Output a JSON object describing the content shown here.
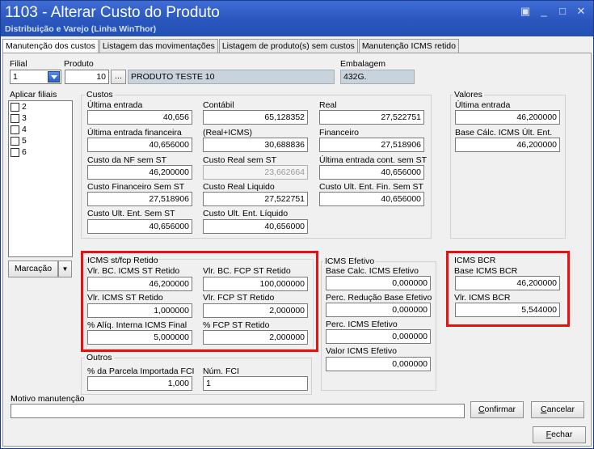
{
  "window": {
    "title": "1103 - Alterar Custo do Produto",
    "subtitle": "Distribuição e Varejo (Linha WinThor)"
  },
  "tabs": [
    {
      "label": "Manutenção dos custos",
      "active": true
    },
    {
      "label": "Listagem das movimentações",
      "active": false
    },
    {
      "label": "Listagem de produto(s)  sem custos",
      "active": false
    },
    {
      "label": "Manutenção ICMS retido",
      "active": false
    }
  ],
  "header": {
    "filial_label": "Filial",
    "filial_value": "1",
    "produto_label": "Produto",
    "produto_code": "10",
    "produto_browse": "...",
    "produto_desc": "PRODUTO TESTE 10",
    "embalagem_label": "Embalagem",
    "embalagem_value": "432G."
  },
  "aplicar_filiais": {
    "label": "Aplicar filiais",
    "items": [
      "2",
      "3",
      "4",
      "5",
      "6"
    ],
    "marcacao_button": "Marcação"
  },
  "custos": {
    "title": "Custos",
    "ultima_entrada": {
      "label": "Última entrada",
      "value": "40,656"
    },
    "contabil": {
      "label": "Contábil",
      "value": "65,128352"
    },
    "real": {
      "label": "Real",
      "value": "27,522751"
    },
    "ult_ent_financeira": {
      "label": "Última entrada financeira",
      "value": "40,656000"
    },
    "real_icms": {
      "label": "(Real+ICMS)",
      "value": "30,688836"
    },
    "financeiro": {
      "label": "Financeiro",
      "value": "27,518906"
    },
    "custo_nf_sem_st": {
      "label": "Custo da NF sem ST",
      "value": "46,200000"
    },
    "custo_real_sem_st": {
      "label": "Custo Real sem ST",
      "value": "23,662664"
    },
    "ult_ent_cont_sem_st": {
      "label": "Última entrada cont. sem ST",
      "value": "40,656000"
    },
    "custo_fin_sem_st": {
      "label": "Custo Financeiro Sem ST",
      "value": "27,518906"
    },
    "custo_real_liquido": {
      "label": "Custo Real Liquido",
      "value": "27,522751"
    },
    "custo_ult_ent_fin_sem_st": {
      "label": "Custo Ult. Ent. Fin. Sem ST",
      "value": "40,656000"
    },
    "custo_ult_ent_sem_st": {
      "label": "Custo Ult. Ent. Sem ST",
      "value": "40,656000"
    },
    "custo_ult_ent_liquido": {
      "label": "Custo Ult. Ent. Líquido",
      "value": "40,656000"
    }
  },
  "valores": {
    "title": "Valores",
    "ultima_entrada": {
      "label": "Última entrada",
      "value": "46,200000"
    },
    "base_calc_icms": {
      "label": "Base Cálc. ICMS Últ. Ent.",
      "value": "46,200000"
    }
  },
  "icms_st": {
    "title": "ICMS st/fcp Retido",
    "vlr_bc_icms_st": {
      "label": "Vlr. BC. ICMS ST Retido",
      "value": "46,200000"
    },
    "vlr_bc_fcp_st": {
      "label": "Vlr. BC. FCP ST Retido",
      "value": "100,000000"
    },
    "vlr_icms_st": {
      "label": "Vlr. ICMS ST Retido",
      "value": "1,000000"
    },
    "vlr_fcp_st": {
      "label": "Vlr. FCP ST Retido",
      "value": "2,000000"
    },
    "aliq_interna": {
      "label": "% Alíq. Interna ICMS Final",
      "value": "5,000000"
    },
    "fcp_st": {
      "label": "% FCP ST Retido",
      "value": "2,000000"
    }
  },
  "icms_efetivo": {
    "title": "ICMS Efetivo",
    "base_calc": {
      "label": "Base Calc. ICMS Efetivo",
      "value": "0,000000"
    },
    "perc_reducao": {
      "label": "Perc. Redução Base Efetivo",
      "value": "0,000000"
    },
    "perc_icms": {
      "label": "Perc. ICMS Efetivo",
      "value": "0,000000"
    },
    "valor_icms": {
      "label": "Valor ICMS Efetivo",
      "value": "0,000000"
    }
  },
  "icms_bcr": {
    "title": "ICMS BCR",
    "base": {
      "label": "Base ICMS BCR",
      "value": "46,200000"
    },
    "vlr": {
      "label": "Vlr. ICMS BCR",
      "value": "5,544000"
    }
  },
  "outros": {
    "title": "Outros",
    "parcela_fci": {
      "label": "% da Parcela Importada FCI",
      "value": "1,000"
    },
    "num_fci": {
      "label": "Núm. FCI",
      "value": "1"
    }
  },
  "motivo": {
    "label": "Motivo manutenção",
    "value": ""
  },
  "buttons": {
    "confirmar": {
      "hotkey": "C",
      "rest": "onfirmar"
    },
    "cancelar": {
      "hotkey": "C",
      "rest": "ancelar"
    },
    "fechar": {
      "hotkey": "F",
      "rest": "echar"
    }
  },
  "colors": {
    "highlight": "#e81010",
    "titlebar": "#2a56bd"
  }
}
